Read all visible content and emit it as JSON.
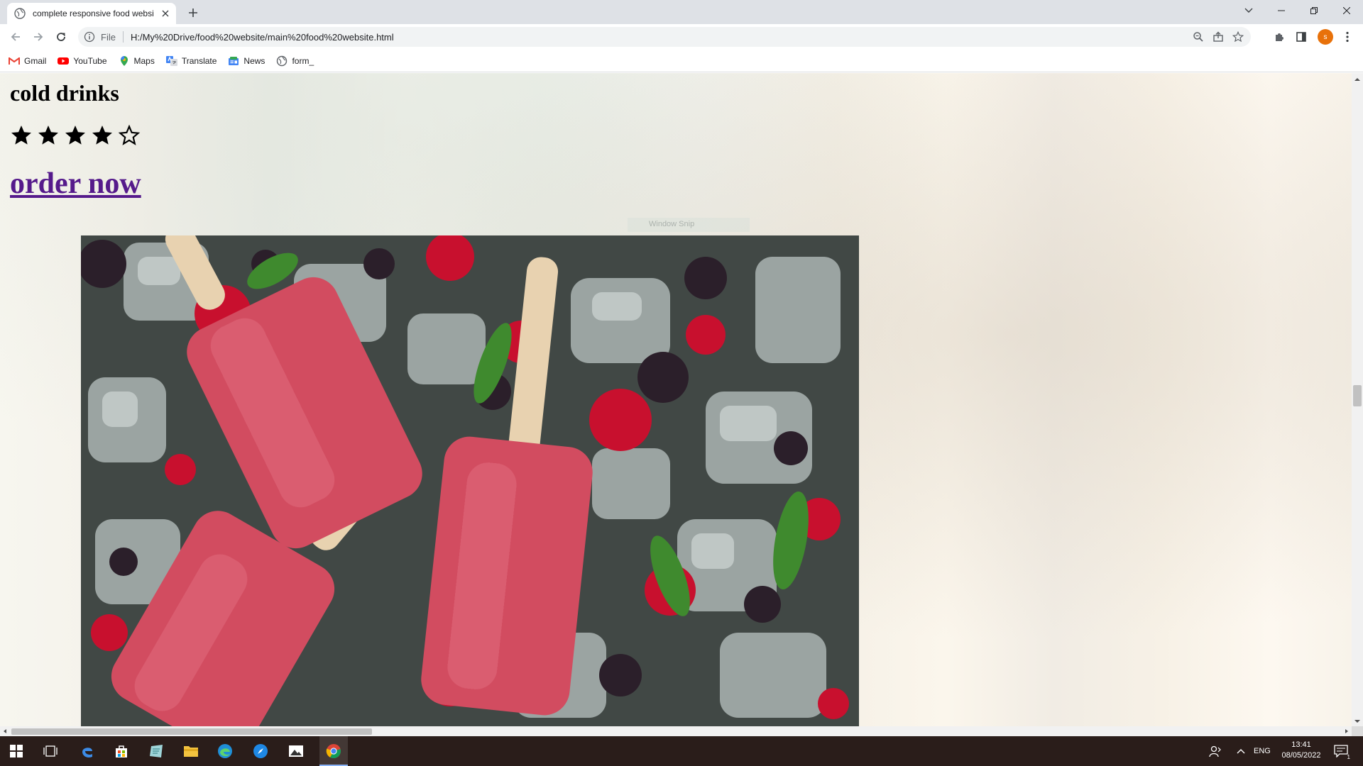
{
  "browser": {
    "tab": {
      "title": "complete responsive food websi",
      "favicon": "globe-icon"
    },
    "new_tab_icon": "plus-icon",
    "window_controls": [
      "chevron-down-icon",
      "minimize-icon",
      "restore-icon",
      "close-icon"
    ],
    "address": {
      "scheme_label": "File",
      "url": "H:/My%20Drive/food%20website/main%20food%20website.html"
    },
    "profile_initial": "s"
  },
  "bookmarks": [
    {
      "label": "Gmail",
      "icon": "gmail-icon"
    },
    {
      "label": "YouTube",
      "icon": "youtube-icon"
    },
    {
      "label": "Maps",
      "icon": "maps-icon"
    },
    {
      "label": "Translate",
      "icon": "translate-icon"
    },
    {
      "label": "News",
      "icon": "news-icon"
    },
    {
      "label": "form_",
      "icon": "globe-icon"
    }
  ],
  "page": {
    "item_title": "cold drinks",
    "rating": {
      "filled": 4,
      "total": 5
    },
    "order_link": "order now",
    "snip_ghost_text": "Window Snip",
    "image_subject": "popsicles-with-berries-and-ice"
  },
  "taskbar": {
    "apps": [
      "windows-start-icon",
      "task-view-icon",
      "edge-legacy-icon",
      "store-icon",
      "notepad-icon",
      "file-explorer-icon",
      "edge-icon",
      "safari-icon",
      "photos-icon",
      "chrome-icon"
    ],
    "language": "ENG",
    "time": "13:41",
    "date": "08/05/2022",
    "notification_count": "1"
  },
  "colors": {
    "link": "#551a8b",
    "taskbar": "#2a1d1a",
    "profile": "#e8710a"
  }
}
